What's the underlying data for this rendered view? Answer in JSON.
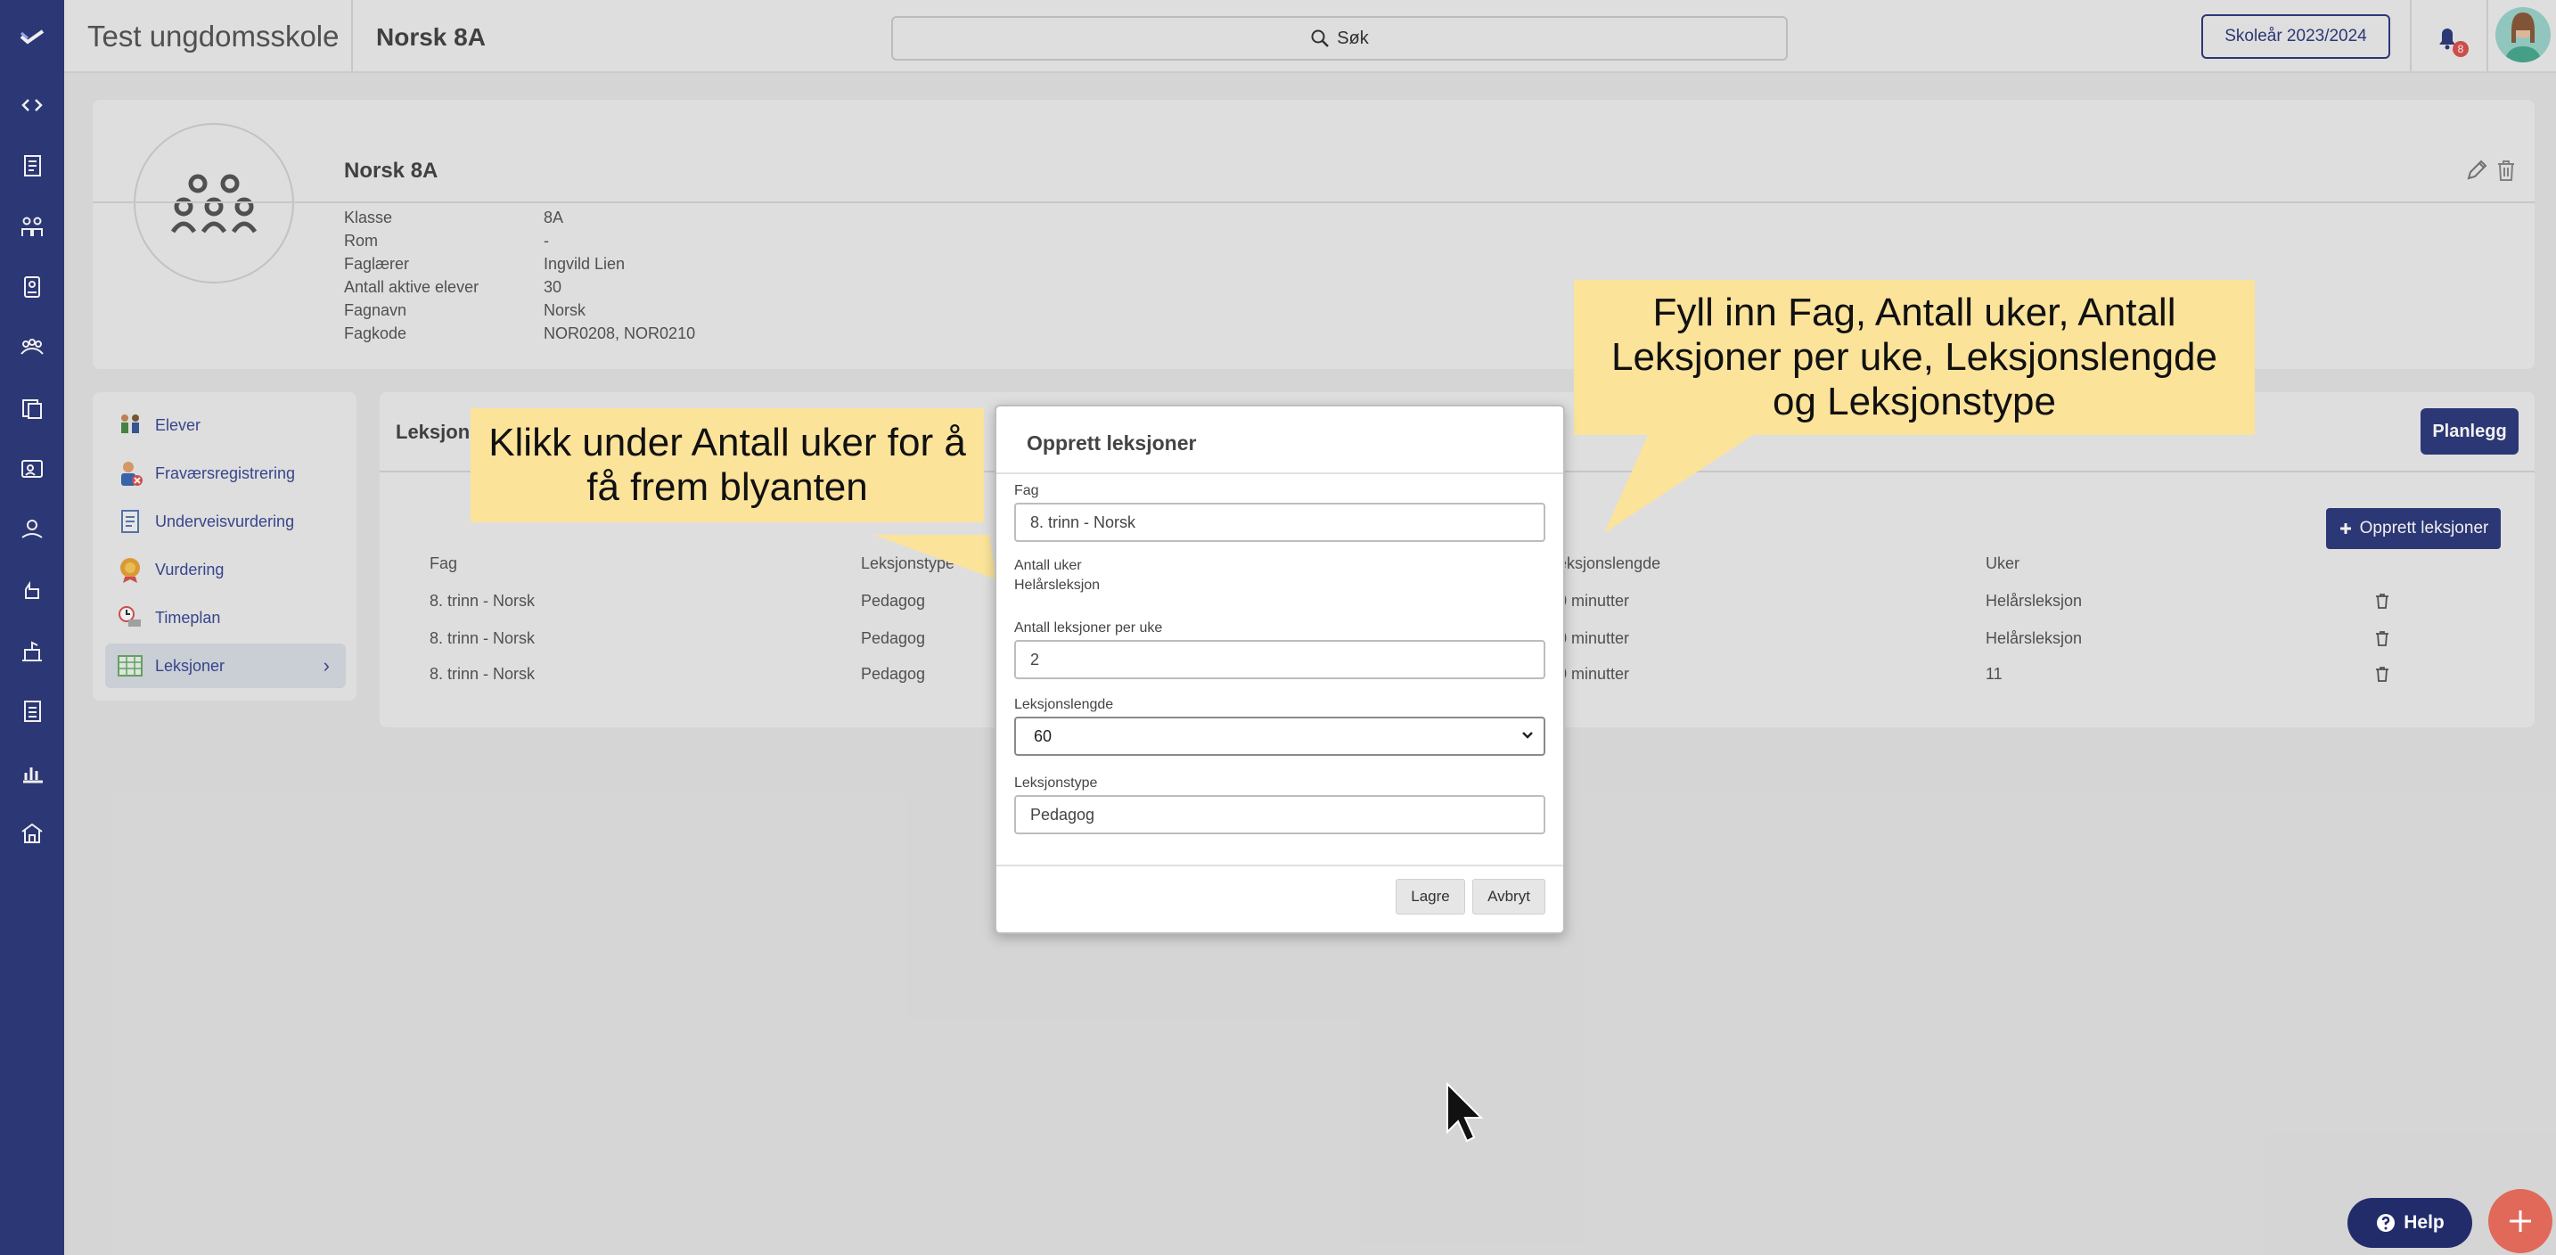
{
  "topbar": {
    "school_name": "Test ungdomsskole",
    "class_title": "Norsk 8A",
    "search_label": "Søk",
    "school_year": "Skoleår 2023/2024",
    "notification_count": "8"
  },
  "info": {
    "title": "Norsk 8A",
    "rows": [
      {
        "label": "Klasse",
        "value": "8A"
      },
      {
        "label": "Rom",
        "value": "-"
      },
      {
        "label": "Faglærer",
        "value": "Ingvild Lien"
      },
      {
        "label": "Antall aktive elever",
        "value": "30"
      },
      {
        "label": "Fagnavn",
        "value": "Norsk"
      },
      {
        "label": "Fagkode",
        "value": "NOR0208, NOR0210"
      }
    ]
  },
  "menu": {
    "items": [
      {
        "label": "Elever",
        "icon": "students-icon"
      },
      {
        "label": "Fraværsregistrering",
        "icon": "absence-icon"
      },
      {
        "label": "Underveisvurdering",
        "icon": "assessment-icon"
      },
      {
        "label": "Vurdering",
        "icon": "award-icon"
      },
      {
        "label": "Timeplan",
        "icon": "timetable-icon"
      },
      {
        "label": "Leksjoner",
        "icon": "lessons-icon",
        "active": true
      }
    ],
    "chevron": "›"
  },
  "lessons": {
    "title": "Leksjoner",
    "planlegg_label": "Planlegg",
    "create_label": "Opprett leksjoner",
    "headers": {
      "fag": "Fag",
      "leksjonstype": "Leksjonstype",
      "leksjonslengde": "Leksjonslengde",
      "uker": "Uker"
    },
    "rows": [
      {
        "fag": "8. trinn - Norsk",
        "type": "Pedagog",
        "length": "60 minutter",
        "weeks": "Helårsleksjon"
      },
      {
        "fag": "8. trinn - Norsk",
        "type": "Pedagog",
        "length": "60 minutter",
        "weeks": "Helårsleksjon"
      },
      {
        "fag": "8. trinn - Norsk",
        "type": "Pedagog",
        "length": "60 minutter",
        "weeks": "11"
      }
    ]
  },
  "modal": {
    "title": "Opprett leksjoner",
    "fag_label": "Fag",
    "fag_value": "8. trinn - Norsk",
    "weeks_label": "Antall uker",
    "weeks_value": "Helårsleksjon",
    "per_week_label": "Antall leksjoner per uke",
    "per_week_value": "2",
    "length_label": "Leksjonslengde",
    "length_value": "60",
    "type_label": "Leksjonstype",
    "type_value": "Pedagog",
    "save_label": "Lagre",
    "cancel_label": "Avbryt"
  },
  "callouts": {
    "left": "Klikk under Antall uker for å få frem blyanten",
    "right": "Fyll inn Fag, Antall uker, Antall Leksjoner per uke, Leksjonslengde og Leksjonstype"
  },
  "help_label": "Help",
  "colors": {
    "sidebar": "#2f3b7d",
    "accent": "#2f3b7d",
    "callout": "#fbe39a",
    "fab": "#e0695a"
  }
}
